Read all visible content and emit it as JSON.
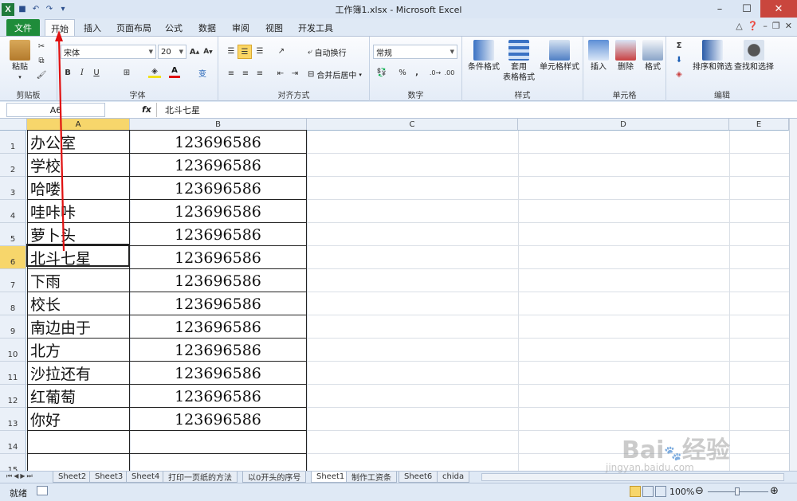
{
  "window": {
    "title": "工作簿1.xlsx - Microsoft Excel",
    "app_icon": "X"
  },
  "menu": {
    "file": "文件",
    "tabs": [
      "开始",
      "插入",
      "页面布局",
      "公式",
      "数据",
      "审阅",
      "视图",
      "开发工具"
    ]
  },
  "ribbon": {
    "clipboard": {
      "label": "剪贴板",
      "paste": "粘贴"
    },
    "font": {
      "label": "字体",
      "font_name": "宋体",
      "font_size": "20",
      "bold": "B",
      "italic": "I",
      "underline": "U"
    },
    "alignment": {
      "label": "对齐方式",
      "wrap": "自动换行",
      "merge": "合并后居中"
    },
    "number": {
      "label": "数字",
      "format": "常规",
      "percent": "%",
      "comma": ","
    },
    "styles": {
      "label": "样式",
      "conditional": "条件格式",
      "table_line1": "套用",
      "table_line2": "表格格式",
      "cell_styles": "单元格样式"
    },
    "cells": {
      "label": "单元格",
      "insert": "插入",
      "delete": "删除",
      "format": "格式"
    },
    "editing": {
      "label": "编辑",
      "sort": "排序和筛选",
      "find": "查找和选择",
      "sigma": "Σ"
    }
  },
  "formula_bar": {
    "name_box": "A6",
    "fx": "fx",
    "content": "北斗七星"
  },
  "columns": [
    "A",
    "B",
    "C",
    "D",
    "E"
  ],
  "rows": [
    {
      "n": "1",
      "a": "办公室",
      "b": "123696586"
    },
    {
      "n": "2",
      "a": "学校",
      "b": "123696586"
    },
    {
      "n": "3",
      "a": "哈喽",
      "b": "123696586"
    },
    {
      "n": "4",
      "a": "哇咔咔",
      "b": "123696586"
    },
    {
      "n": "5",
      "a": "萝卜头",
      "b": "123696586"
    },
    {
      "n": "6",
      "a": "北斗七星",
      "b": "123696586"
    },
    {
      "n": "7",
      "a": "下雨",
      "b": "123696586"
    },
    {
      "n": "8",
      "a": "校长",
      "b": "123696586"
    },
    {
      "n": "9",
      "a": "南边由于",
      "b": "123696586"
    },
    {
      "n": "10",
      "a": "北方",
      "b": "123696586"
    },
    {
      "n": "11",
      "a": "沙拉还有",
      "b": "123696586"
    },
    {
      "n": "12",
      "a": "红葡萄",
      "b": "123696586"
    },
    {
      "n": "13",
      "a": "你好",
      "b": "123696586"
    },
    {
      "n": "14",
      "a": "",
      "b": ""
    },
    {
      "n": "15",
      "a": "",
      "b": ""
    }
  ],
  "sheet_tabs": [
    "Sheet2",
    "Sheet3",
    "Sheet4",
    "打印一页纸的方法",
    "以0开头的序号",
    "Sheet1",
    "制作工资条",
    "Sheet6",
    "chida"
  ],
  "active_sheet": "Sheet1",
  "status": {
    "ready": "就绪",
    "zoom": "100%"
  },
  "watermark": {
    "text": "Bai经验",
    "url": "jingyan.baidu.com"
  },
  "colors": {
    "accent_green": "#1f8c3a",
    "selection_yellow": "#f7d66b",
    "annotation_red": "#e01010"
  }
}
